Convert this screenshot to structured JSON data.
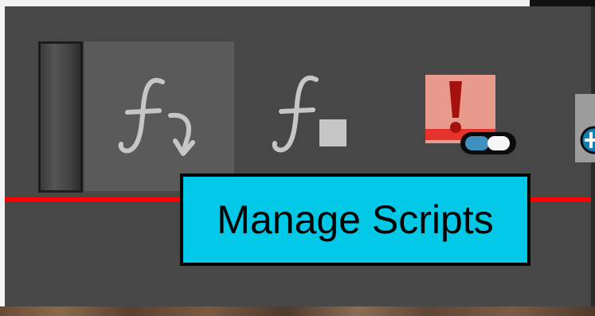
{
  "toolbar": {
    "buttons": [
      {
        "id": "manage-scripts",
        "icon": "function-arrow-icon",
        "active": true
      },
      {
        "id": "run-script",
        "icon": "function-stop-icon",
        "active": false
      },
      {
        "id": "debugger",
        "icon": "alert-capsule-icon",
        "active": false
      },
      {
        "id": "add-item",
        "icon": "add-plus-icon",
        "active": false
      }
    ]
  },
  "tooltip": {
    "text": "Manage Scripts"
  },
  "colors": {
    "toolbar_bg": "#474747",
    "active_bg": "#5a5a5a",
    "accent_line": "#ff0000",
    "tooltip_bg": "#00c8e6",
    "icon_gray": "#c6c6c6"
  }
}
